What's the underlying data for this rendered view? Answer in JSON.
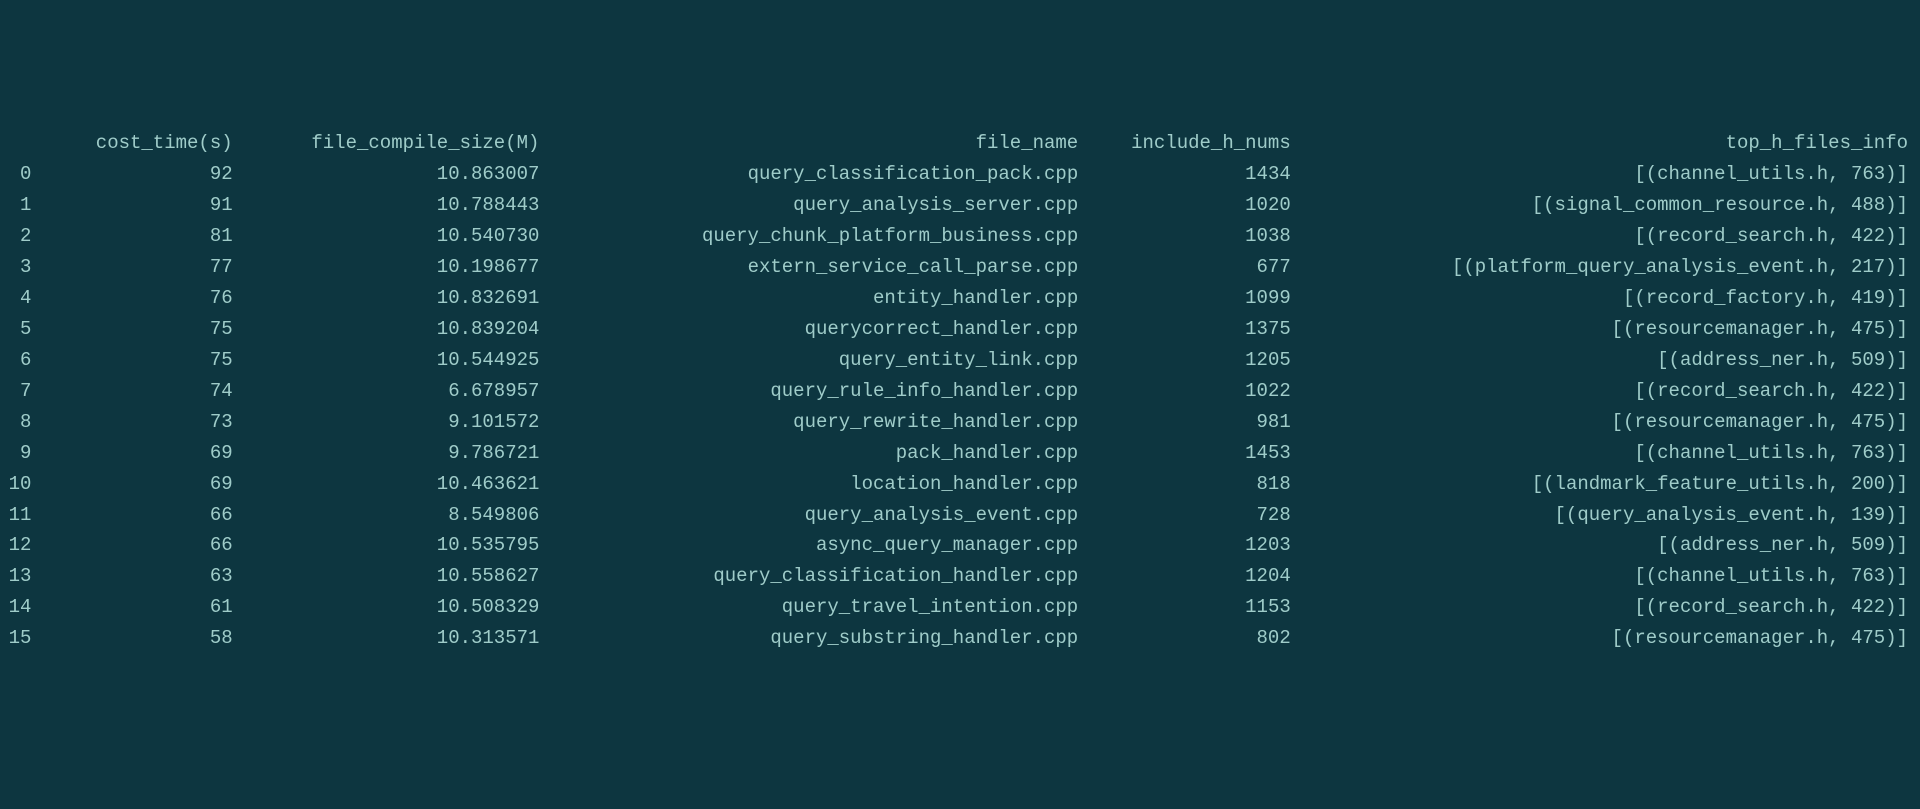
{
  "headers": {
    "index": "",
    "cost_time": "cost_time(s)",
    "file_compile_size": "file_compile_size(M)",
    "file_name": "file_name",
    "include_h_nums": "include_h_nums",
    "top_h_files_info": "top_h_files_info"
  },
  "rows": [
    {
      "index": "0",
      "cost_time": "92",
      "file_compile_size": "10.863007",
      "file_name": "query_classification_pack.cpp",
      "include_h_nums": "1434",
      "top_h_files_info": "[(channel_utils.h, 763)]"
    },
    {
      "index": "1",
      "cost_time": "91",
      "file_compile_size": "10.788443",
      "file_name": "query_analysis_server.cpp",
      "include_h_nums": "1020",
      "top_h_files_info": "[(signal_common_resource.h, 488)]"
    },
    {
      "index": "2",
      "cost_time": "81",
      "file_compile_size": "10.540730",
      "file_name": "query_chunk_platform_business.cpp",
      "include_h_nums": "1038",
      "top_h_files_info": "[(record_search.h, 422)]"
    },
    {
      "index": "3",
      "cost_time": "77",
      "file_compile_size": "10.198677",
      "file_name": "extern_service_call_parse.cpp",
      "include_h_nums": "677",
      "top_h_files_info": "[(platform_query_analysis_event.h, 217)]"
    },
    {
      "index": "4",
      "cost_time": "76",
      "file_compile_size": "10.832691",
      "file_name": "entity_handler.cpp",
      "include_h_nums": "1099",
      "top_h_files_info": "[(record_factory.h, 419)]"
    },
    {
      "index": "5",
      "cost_time": "75",
      "file_compile_size": "10.839204",
      "file_name": "querycorrect_handler.cpp",
      "include_h_nums": "1375",
      "top_h_files_info": "[(resourcemanager.h, 475)]"
    },
    {
      "index": "6",
      "cost_time": "75",
      "file_compile_size": "10.544925",
      "file_name": "query_entity_link.cpp",
      "include_h_nums": "1205",
      "top_h_files_info": "[(address_ner.h, 509)]"
    },
    {
      "index": "7",
      "cost_time": "74",
      "file_compile_size": "6.678957",
      "file_name": "query_rule_info_handler.cpp",
      "include_h_nums": "1022",
      "top_h_files_info": "[(record_search.h, 422)]"
    },
    {
      "index": "8",
      "cost_time": "73",
      "file_compile_size": "9.101572",
      "file_name": "query_rewrite_handler.cpp",
      "include_h_nums": "981",
      "top_h_files_info": "[(resourcemanager.h, 475)]"
    },
    {
      "index": "9",
      "cost_time": "69",
      "file_compile_size": "9.786721",
      "file_name": "pack_handler.cpp",
      "include_h_nums": "1453",
      "top_h_files_info": "[(channel_utils.h, 763)]"
    },
    {
      "index": "10",
      "cost_time": "69",
      "file_compile_size": "10.463621",
      "file_name": "location_handler.cpp",
      "include_h_nums": "818",
      "top_h_files_info": "[(landmark_feature_utils.h, 200)]"
    },
    {
      "index": "11",
      "cost_time": "66",
      "file_compile_size": "8.549806",
      "file_name": "query_analysis_event.cpp",
      "include_h_nums": "728",
      "top_h_files_info": "[(query_analysis_event.h, 139)]"
    },
    {
      "index": "12",
      "cost_time": "66",
      "file_compile_size": "10.535795",
      "file_name": "async_query_manager.cpp",
      "include_h_nums": "1203",
      "top_h_files_info": "[(address_ner.h, 509)]"
    },
    {
      "index": "13",
      "cost_time": "63",
      "file_compile_size": "10.558627",
      "file_name": "query_classification_handler.cpp",
      "include_h_nums": "1204",
      "top_h_files_info": "[(channel_utils.h, 763)]"
    },
    {
      "index": "14",
      "cost_time": "61",
      "file_compile_size": "10.508329",
      "file_name": "query_travel_intention.cpp",
      "include_h_nums": "1153",
      "top_h_files_info": "[(record_search.h, 422)]"
    },
    {
      "index": "15",
      "cost_time": "58",
      "file_compile_size": "10.313571",
      "file_name": "query_substring_handler.cpp",
      "include_h_nums": "802",
      "top_h_files_info": "[(resourcemanager.h, 475)]"
    }
  ]
}
